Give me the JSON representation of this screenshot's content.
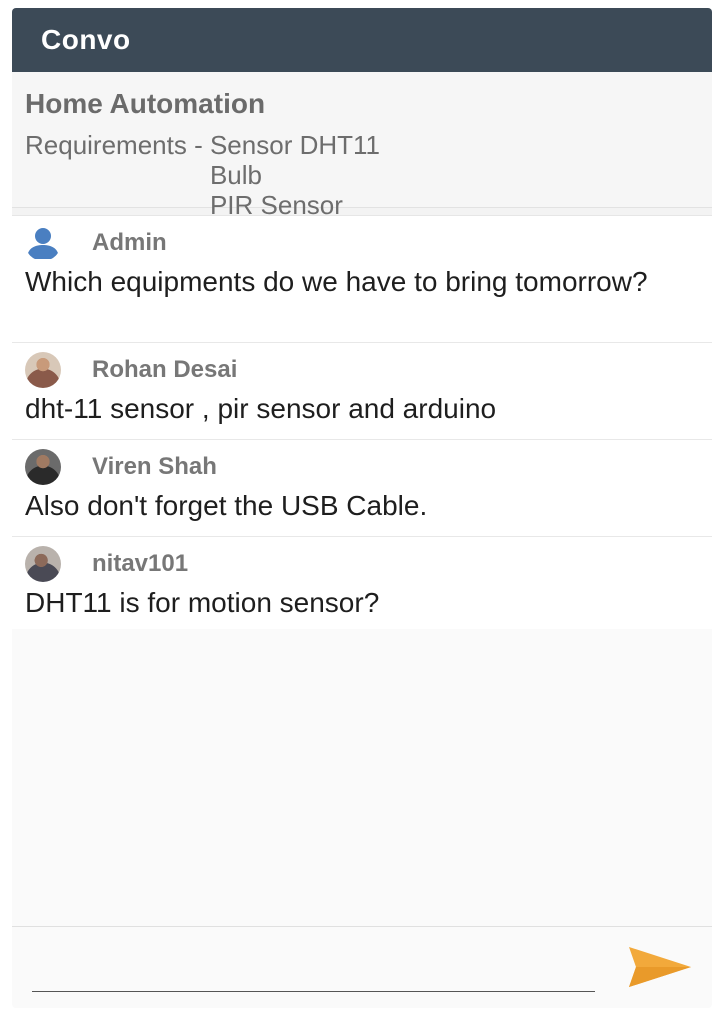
{
  "app": {
    "title": "Convo"
  },
  "group": {
    "title": "Home Automation",
    "requirements_label": "Requirements - ",
    "requirements": [
      "Sensor DHT11",
      "Bulb",
      "PIR Sensor"
    ]
  },
  "messages": [
    {
      "sender": "Admin",
      "text": "Which equipments do we have to bring tomorrow?",
      "avatar": "person-icon"
    },
    {
      "sender": "Rohan Desai",
      "text": "dht-11 sensor , pir sensor and arduino",
      "avatar": "profile-photo"
    },
    {
      "sender": "Viren Shah",
      "text": "Also don't forget the USB Cable.",
      "avatar": "profile-photo"
    },
    {
      "sender": "nitav101",
      "text": "DHT11 is for motion sensor?",
      "avatar": "profile-photo"
    }
  ],
  "composer": {
    "value": "",
    "placeholder": "",
    "send_icon": "send-icon"
  },
  "colors": {
    "appbar": "#3c4a57",
    "send_accent": "#f2a93b",
    "admin_avatar": "#4a7fc1"
  }
}
